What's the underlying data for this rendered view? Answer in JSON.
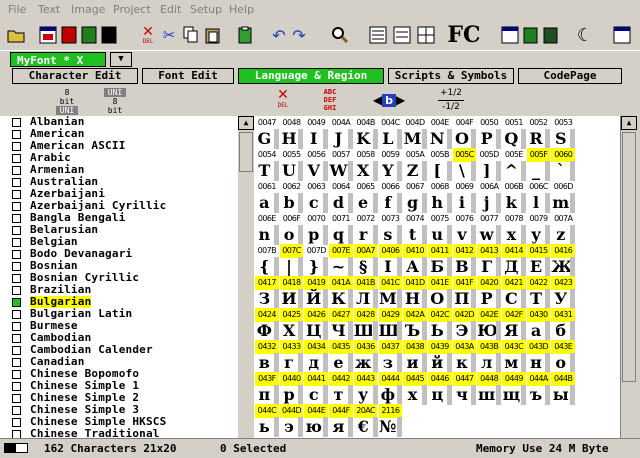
{
  "menu": [
    "File",
    "Text",
    "Image",
    "Project",
    "Edit",
    "Setup",
    "Help"
  ],
  "toolbar": {
    "delete_label": "DEL",
    "logo": "FC"
  },
  "file_tabs": {
    "font": "MyFont * X",
    "dropdown": "▼"
  },
  "mode_tabs": [
    "Character Edit",
    "Font Edit",
    "Language & Region",
    "Scripts & Symbols",
    "CodePage"
  ],
  "subtoolbar": {
    "bit8_uni": "8 bit",
    "uni_label": "UNI",
    "uni_8bit": "8 bit",
    "del_label": "DEL",
    "abc": [
      "ABC",
      "DEF",
      "GHI"
    ],
    "b_label": "b",
    "frac_top": "+1/2",
    "frac_bot": "-1/2"
  },
  "languages": [
    "Albanian",
    "American",
    "American ASCII",
    "Arabic",
    "Armenian",
    "Australian",
    "Azerbaijani",
    "Azerbaijani Cyrillic",
    "Bangla Bengali",
    "Belarusian",
    "Belgian",
    "Bodo Devanagari",
    "Bosnian",
    "Bosnian Cyrillic",
    "Brazilian",
    "Bulgarian",
    "Bulgarian Latin",
    "Burmese",
    "Cambodian",
    "Cambodian Calender",
    "Canadian",
    "Chinese Bopomofo",
    "Chinese Simple 1",
    "Chinese Simple 2",
    "Chinese Simple 3",
    "Chinese Simple HKSCS",
    "Chinese Traditional"
  ],
  "selected_language": "Bulgarian",
  "grid_rows": [
    {
      "codes": [
        "0047",
        "0048",
        "0049",
        "004A",
        "004B",
        "004C",
        "004D",
        "004E",
        "004F",
        "0050",
        "0051",
        "0052",
        "0053"
      ],
      "hl": [],
      "glyphs": [
        "G",
        "H",
        "I",
        "J",
        "K",
        "L",
        "M",
        "N",
        "O",
        "P",
        "Q",
        "R",
        "S"
      ]
    },
    {
      "codes": [
        "0054",
        "0055",
        "0056",
        "0057",
        "0058",
        "0059",
        "005A",
        "005B",
        "005C",
        "005D",
        "005E",
        "005F",
        "0060"
      ],
      "hl": [
        8,
        11,
        12
      ],
      "glyphs": [
        "T",
        "U",
        "V",
        "W",
        "X",
        "Y",
        "Z",
        "[",
        "\\",
        "]",
        "^",
        "_",
        "`"
      ]
    },
    {
      "codes": [
        "0061",
        "0062",
        "0063",
        "0064",
        "0065",
        "0066",
        "0067",
        "0068",
        "0069",
        "006A",
        "006B",
        "006C",
        "006D"
      ],
      "hl": [],
      "glyphs": [
        "a",
        "b",
        "c",
        "d",
        "e",
        "f",
        "g",
        "h",
        "i",
        "j",
        "k",
        "l",
        "m"
      ]
    },
    {
      "codes": [
        "006E",
        "006F",
        "0070",
        "0071",
        "0072",
        "0073",
        "0074",
        "0075",
        "0076",
        "0077",
        "0078",
        "0079",
        "007A"
      ],
      "hl": [],
      "glyphs": [
        "n",
        "o",
        "p",
        "q",
        "r",
        "s",
        "t",
        "u",
        "v",
        "w",
        "x",
        "y",
        "z"
      ]
    },
    {
      "codes": [
        "007B",
        "007C",
        "007D",
        "007E",
        "00A7",
        "0406",
        "0410",
        "0411",
        "0412",
        "0413",
        "0414",
        "0415",
        "0416"
      ],
      "hl": [
        1,
        3,
        4,
        5,
        6,
        7,
        8,
        9,
        10,
        11,
        12
      ],
      "glyphs": [
        "{",
        "|",
        "}",
        "~",
        "§",
        "І",
        "А",
        "Б",
        "В",
        "Г",
        "Д",
        "Е",
        "Ж"
      ]
    },
    {
      "codes": [
        "0417",
        "0418",
        "0419",
        "041A",
        "041B",
        "041C",
        "041D",
        "041E",
        "041F",
        "0420",
        "0421",
        "0422",
        "0423"
      ],
      "hl": [
        0,
        1,
        2,
        3,
        4,
        5,
        6,
        7,
        8,
        9,
        10,
        11,
        12
      ],
      "glyphs": [
        "З",
        "И",
        "Й",
        "К",
        "Л",
        "М",
        "Н",
        "О",
        "П",
        "Р",
        "С",
        "Т",
        "У"
      ]
    },
    {
      "codes": [
        "0424",
        "0425",
        "0426",
        "0427",
        "0428",
        "0429",
        "042A",
        "042C",
        "042D",
        "042E",
        "042F",
        "0430",
        "0431"
      ],
      "hl": [
        0,
        1,
        2,
        3,
        4,
        5,
        6,
        7,
        8,
        9,
        10,
        11,
        12
      ],
      "glyphs": [
        "Ф",
        "Х",
        "Ц",
        "Ч",
        "Ш",
        "Щ",
        "Ъ",
        "Ь",
        "Э",
        "Ю",
        "Я",
        "а",
        "б"
      ]
    },
    {
      "codes": [
        "0432",
        "0433",
        "0434",
        "0435",
        "0436",
        "0437",
        "0438",
        "0439",
        "043A",
        "043B",
        "043C",
        "043D",
        "043E"
      ],
      "hl": [
        0,
        1,
        2,
        3,
        4,
        5,
        6,
        7,
        8,
        9,
        10,
        11,
        12
      ],
      "glyphs": [
        "в",
        "г",
        "д",
        "е",
        "ж",
        "з",
        "и",
        "й",
        "к",
        "л",
        "м",
        "н",
        "о"
      ]
    },
    {
      "codes": [
        "043F",
        "0440",
        "0441",
        "0442",
        "0443",
        "0444",
        "0445",
        "0446",
        "0447",
        "0448",
        "0449",
        "044A",
        "044B"
      ],
      "hl": [
        0,
        1,
        2,
        3,
        4,
        5,
        6,
        7,
        8,
        9,
        10,
        11,
        12
      ],
      "glyphs": [
        "п",
        "р",
        "с",
        "т",
        "у",
        "ф",
        "х",
        "ц",
        "ч",
        "ш",
        "щ",
        "ъ",
        "ы"
      ]
    },
    {
      "codes": [
        "044C",
        "044D",
        "044E",
        "044F",
        "20AC",
        "2116"
      ],
      "hl": [
        0,
        1,
        2,
        3,
        4,
        5
      ],
      "glyphs": [
        "ь",
        "э",
        "ю",
        "я",
        "€",
        "№"
      ]
    }
  ],
  "status": {
    "count": "162 Characters 21x20",
    "selected": "0 Selected",
    "memory": "Memory Use 24 M Byte"
  },
  "colors": {
    "accent": "#20c020",
    "highlight": "#ffff00"
  }
}
